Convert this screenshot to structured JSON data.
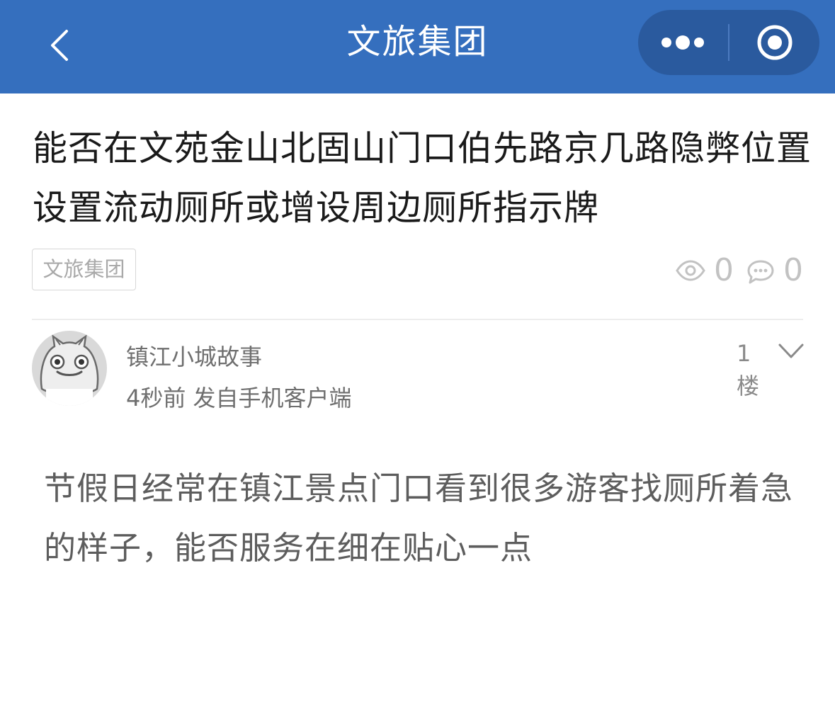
{
  "navbar": {
    "title": "文旅集团",
    "back_icon": "chevron-left-icon",
    "more_icon": "more-dots-icon",
    "close_icon": "target-circle-icon",
    "background_color": "#356fbe"
  },
  "post": {
    "title": "能否在文苑金山北固山门口伯先路京几路隐弊位置设置流动厕所或增设周边厕所指示牌",
    "tag": "文旅集团",
    "views": "0",
    "comments": "0"
  },
  "reply": {
    "author": "镇江小城故事",
    "meta": "4秒前 发自手机客户端",
    "floor": "1楼",
    "content": "节假日经常在镇江景点门口看到很多游客找厕所着急的样子，能否服务在细在贴心一点"
  }
}
